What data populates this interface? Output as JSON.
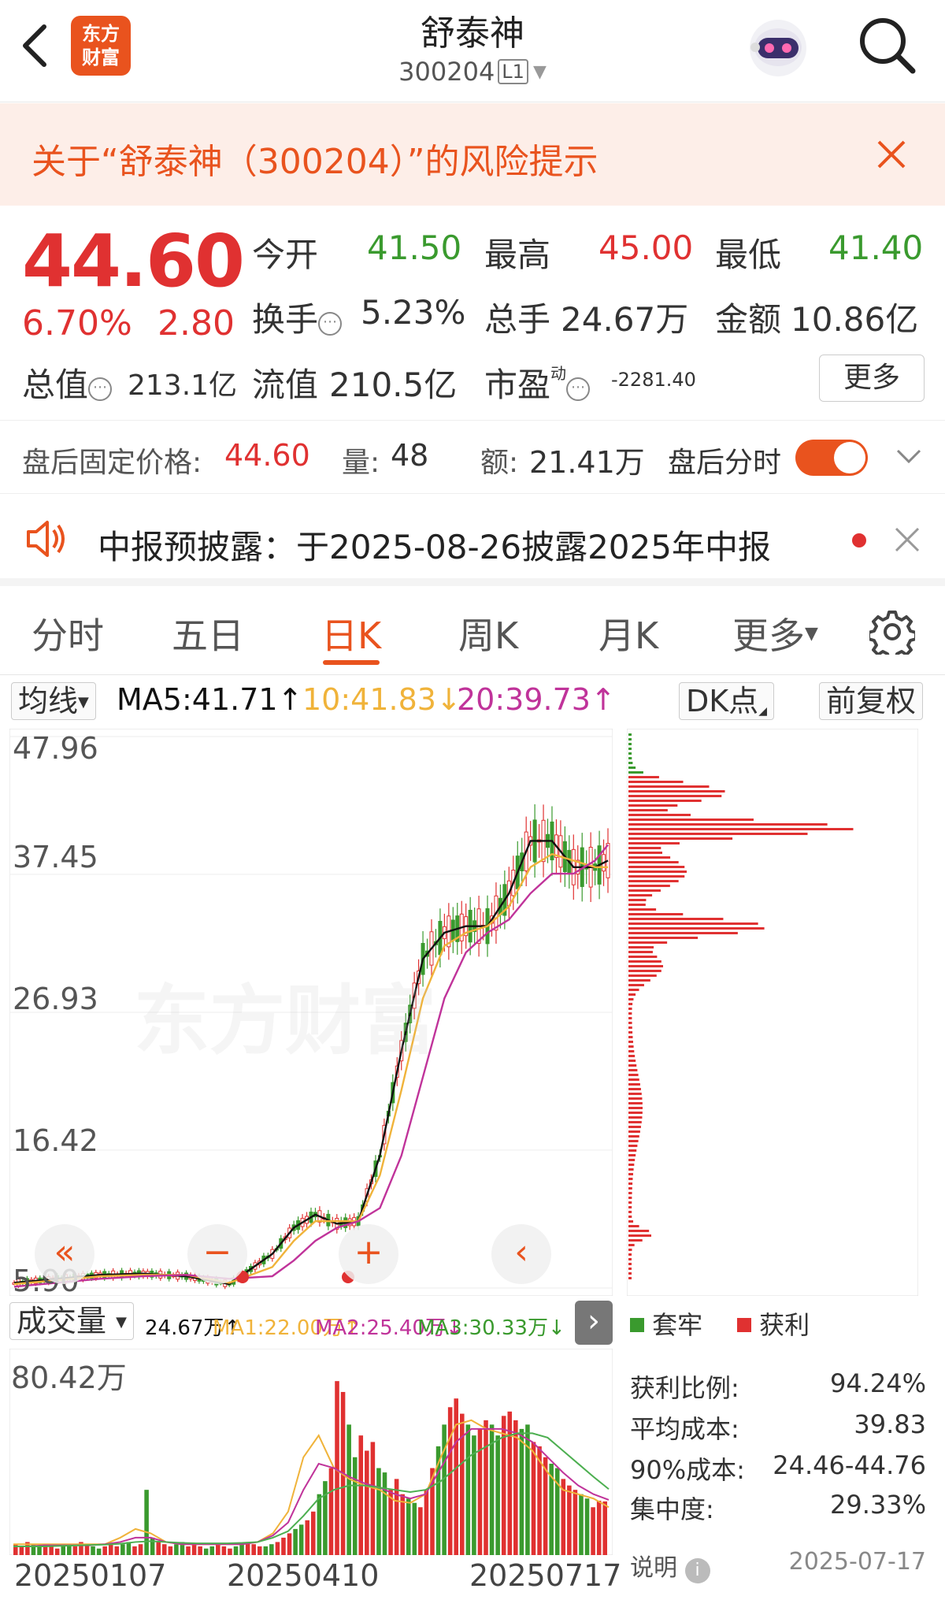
{
  "header": {
    "title": "舒泰神",
    "code": "300204",
    "level": "L1",
    "logo_line1": "东方",
    "logo_line2": "财富"
  },
  "risk_banner": {
    "text": "关于“舒泰神（300204）”的风险提示"
  },
  "quote": {
    "price": "44.60",
    "change_pct": "6.70%",
    "change": "2.80",
    "open_label": "今开",
    "open": "41.50",
    "high_label": "最高",
    "high": "45.00",
    "low_label": "最低",
    "low": "41.40",
    "turnover_label": "换手",
    "turnover": "5.23%",
    "volume_label": "总手",
    "volume": "24.67万",
    "amount_label": "金额",
    "amount": "10.86亿",
    "mcap_label": "总值",
    "mcap": "213.1亿",
    "float_label": "流值",
    "float": "210.5亿",
    "pe_label": "市盈",
    "pe_super": "动",
    "pe": "-2281.40",
    "more": "更多"
  },
  "after_hours": {
    "price_label": "盘后固定价格:",
    "price": "44.60",
    "vol_label": "量:",
    "vol": "48",
    "amt_label": "额:",
    "amt": "21.41万",
    "intraday_label": "盘后分时",
    "toggle_on": true
  },
  "notice": {
    "text": "中报预披露：于2025-08-26披露2025年中报"
  },
  "tabs": [
    {
      "label": "分时"
    },
    {
      "label": "五日"
    },
    {
      "label": "日K",
      "active": true
    },
    {
      "label": "周K"
    },
    {
      "label": "月K"
    },
    {
      "label": "更多"
    }
  ],
  "ma_bar": {
    "type": "均线",
    "ma5": "MA5:41.71",
    "ma10": "10:41.83",
    "ma20": "20:39.73",
    "dk": "DK点",
    "adjust": "前复权"
  },
  "watermark": "东方财富",
  "volume_bar": {
    "label": "成交量",
    "vol": "24.67万",
    "ma1": "MA1:22.00万",
    "ma2": "MA2:25.40万",
    "ma3": "MA3:30.33万"
  },
  "chip_legend": {
    "trapped": "套牢",
    "profit": "获利"
  },
  "chip_stats": [
    {
      "label": "获利比例:",
      "value": "94.24%"
    },
    {
      "label": "平均成本:",
      "value": "39.83"
    },
    {
      "label": "90%成本:",
      "value": "24.46-44.76"
    },
    {
      "label": "集中度:",
      "value": "29.33%"
    }
  ],
  "chip_footer": {
    "label": "说明",
    "date": "2025-07-17"
  },
  "colors": {
    "accent": "#e9531e",
    "up": "#e03131",
    "down": "#3a9a2e",
    "ma5": "#111111",
    "ma10": "#f0b33a",
    "ma20": "#c0339a",
    "vol_ma3": "#4caf50"
  },
  "chart_data": [
    {
      "type": "line",
      "title": "",
      "y_ticks": [
        "47.96",
        "37.45",
        "26.93",
        "16.42",
        "5.90"
      ],
      "ylim": [
        5.9,
        47.96
      ],
      "x": [
        0,
        10,
        20,
        30,
        40,
        50,
        60,
        65,
        70,
        75,
        80,
        85,
        90,
        95,
        100,
        105,
        110,
        115,
        120,
        125,
        130,
        135,
        138
      ],
      "series": [
        {
          "name": "MA5",
          "values": [
            6.3,
            6.6,
            6.9,
            7.0,
            6.8,
            6.2,
            8.5,
            10.5,
            11.5,
            10.8,
            11.0,
            16,
            24,
            31,
            33,
            33.5,
            33.5,
            36,
            40,
            40,
            38,
            38,
            38.5
          ]
        },
        {
          "name": "10",
          "values": [
            6.2,
            6.5,
            6.8,
            6.9,
            6.9,
            6.3,
            7.5,
            9.5,
            11,
            11,
            11,
            14.5,
            21,
            28,
            32,
            33,
            33.5,
            35,
            38,
            39,
            38.5,
            38,
            38
          ]
        },
        {
          "name": "20",
          "values": [
            6.0,
            6.3,
            6.6,
            6.8,
            6.9,
            6.6,
            6.8,
            8,
            9.5,
            10.5,
            11,
            12,
            16,
            22,
            28,
            31.5,
            33,
            34,
            36,
            37.5,
            37.5,
            38.5,
            39.7
          ]
        }
      ]
    },
    {
      "type": "bar",
      "title": "",
      "y_ticks": [
        "80.42万"
      ],
      "ylim": [
        0,
        80.42
      ],
      "values": [
        5,
        4,
        6,
        5,
        4,
        5,
        4,
        3,
        4,
        5,
        4,
        6,
        5,
        4,
        3,
        4,
        5,
        4,
        5,
        6,
        4,
        5,
        30,
        8,
        6,
        5,
        4,
        5,
        6,
        4,
        5,
        4,
        3,
        4,
        5,
        4,
        3,
        4,
        5,
        6,
        5,
        4,
        4,
        5,
        6,
        8,
        10,
        12,
        14,
        16,
        20,
        28,
        34,
        40,
        80,
        75,
        60,
        45,
        55,
        48,
        52,
        40,
        38,
        30,
        35,
        28,
        26,
        24,
        22,
        30,
        40,
        50,
        60,
        68,
        72,
        65,
        60,
        55,
        58,
        62,
        60,
        55,
        64,
        66,
        62,
        58,
        60,
        52,
        50,
        45,
        42,
        40,
        35,
        32,
        30,
        28,
        26,
        22,
        25,
        24.67
      ],
      "series": [
        {
          "name": "MA1",
          "values": [
            5,
            5,
            5,
            5,
            5,
            5,
            5,
            8,
            12,
            10,
            6,
            5,
            5,
            5,
            5,
            5,
            6,
            10,
            20,
            45,
            55,
            40,
            35,
            32,
            30,
            25,
            24,
            28,
            45,
            60,
            62,
            58,
            56,
            54,
            48,
            38,
            30,
            28,
            26,
            22
          ]
        },
        {
          "name": "MA2",
          "values": [
            4,
            4,
            4.5,
            4.5,
            4.5,
            4.5,
            5,
            6,
            8,
            8,
            6,
            5,
            5,
            5,
            5,
            5,
            6,
            9,
            15,
            30,
            42,
            40,
            36,
            33,
            31,
            28,
            26,
            28,
            40,
            52,
            58,
            58,
            58,
            56,
            52,
            45,
            38,
            32,
            28,
            25.4
          ]
        },
        {
          "name": "MA3",
          "values": [
            4,
            4,
            4,
            4.2,
            4.4,
            4.6,
            4.8,
            5.2,
            6,
            6.4,
            6,
            5.6,
            5.4,
            5.4,
            5.4,
            5.6,
            6,
            8,
            11,
            18,
            26,
            30,
            32,
            32,
            31,
            30,
            29,
            30,
            34,
            40,
            46,
            50,
            54,
            56,
            56,
            54,
            48,
            42,
            36,
            30.33
          ]
        }
      ]
    }
  ],
  "x_dates": [
    "20250107",
    "20250410",
    "20250717"
  ]
}
